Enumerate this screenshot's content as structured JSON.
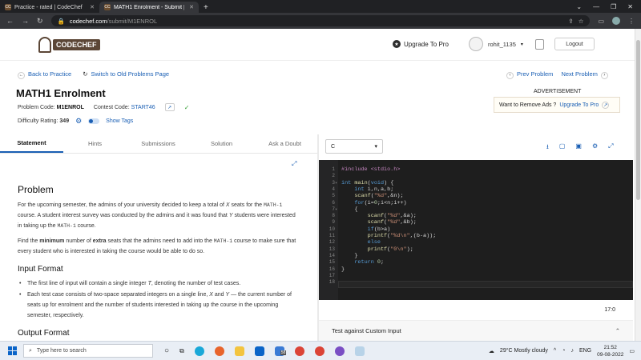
{
  "browser": {
    "tabs": [
      {
        "title": "Practice - rated | CodeChef",
        "active": false
      },
      {
        "title": "MATH1 Enrolment - Submit | CodeChef",
        "active": true
      }
    ],
    "url_host": "codechef.com",
    "url_path": "/submit/M1ENROL"
  },
  "site": {
    "logo_text": "CODECHEF",
    "upgrade_label": "Upgrade To Pro",
    "username": "rohit_1135",
    "logout_label": "Logout"
  },
  "nav": {
    "back_label": "Back to Practice",
    "old_page_label": "Switch to Old Problems Page",
    "prev_label": "Prev Problem",
    "next_label": "Next Problem"
  },
  "problem": {
    "title": "MATH1 Enrolment",
    "code_label": "Problem Code:",
    "code": "M1ENROL",
    "contest_label": "Contest Code:",
    "contest": "START46",
    "difficulty_label": "Difficulty Rating:",
    "difficulty": "349",
    "show_tags": "Show Tags"
  },
  "ad": {
    "label": "ADVERTISEMENT",
    "text": "Want to Remove Ads ?",
    "link": "Upgrade To Pro"
  },
  "tabs": [
    "Statement",
    "Hints",
    "Submissions",
    "Solution",
    "Ask a Doubt"
  ],
  "statement": {
    "heading": "Problem",
    "p1a": "For the upcoming semester, the admins of your university decided to keep a total of ",
    "var_x": "X",
    "p1b": " seats for the ",
    "code_math": "MATH-1",
    "p1c": " course. A student interest survey was conducted by the admins and it was found that ",
    "var_y": "Y",
    "p1d": " students were interested in taking up the ",
    "p1e": " course.",
    "p2a": "Find the ",
    "p2_minimum": "minimum",
    "p2b": " number of ",
    "p2_extra": "extra",
    "p2c": " seats that the admins need to add into the ",
    "p2d": " course to make sure that every student who is interested in taking the course would be able to do so.",
    "input_heading": "Input Format",
    "b1a": "The first line of input will contain a single integer ",
    "var_t": "T",
    "b1b": ", denoting the number of test cases.",
    "b2a": "Each test case consists of two-space separated integers on a single line, ",
    "b2_and": " and ",
    "b2b": " — the current number of seats up for enrolment and the number of students interested in taking up the course in the upcoming semester, respectively.",
    "output_heading": "Output Format"
  },
  "editor": {
    "language": "C",
    "lines": [
      "#include <stdio.h>",
      "",
      "int main(void) {",
      "    int i,n,a,b;",
      "    scanf(\"%d\",&n);",
      "    for(i=0;i<n;i++)",
      "    {",
      "        scanf(\"%d\",&a);",
      "        scanf(\"%d\",&b);",
      "        if(b>a)",
      "        printf(\"%d\\n\",(b-a));",
      "        else",
      "        printf(\"0\\n\");",
      "    }",
      "    return 0;",
      "}",
      "",
      ""
    ],
    "cursor_pos": "17:0",
    "custom_test_label": "Test against Custom Input"
  },
  "taskbar": {
    "search_placeholder": "Type here to search",
    "weather": "29°C  Mostly cloudy",
    "lang": "ENG",
    "time": "21:52",
    "date": "09-08-2022",
    "badge": "58"
  }
}
